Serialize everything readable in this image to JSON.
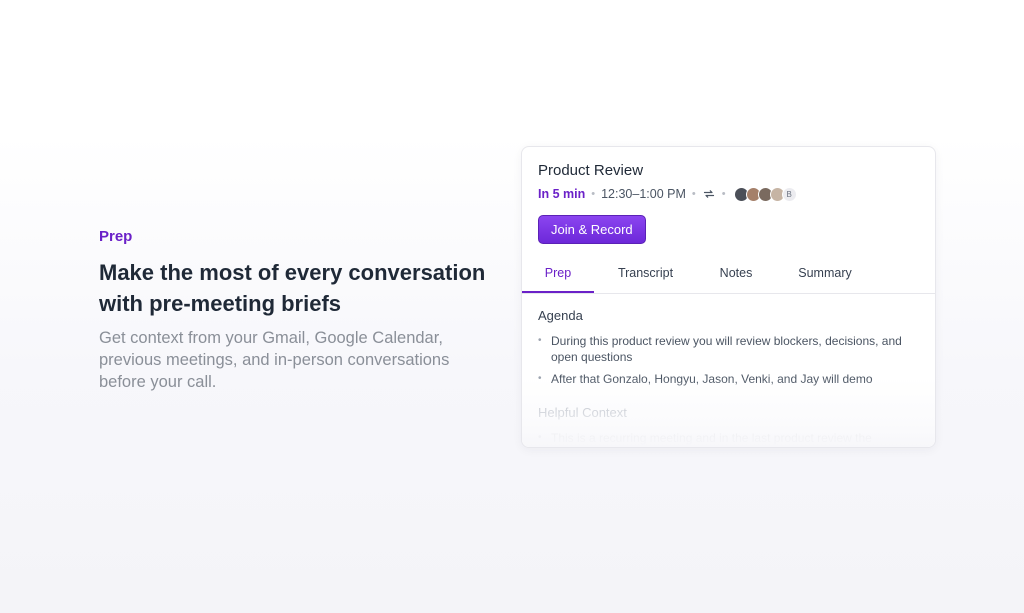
{
  "hero": {
    "eyebrow": "Prep",
    "headline_line1": "Make the most of every conversation",
    "headline_line2": "with pre-meeting briefs",
    "subhead_line1": "Get context from your Gmail, Google Calendar,",
    "subhead_line2": "previous meetings, and in-person conversations",
    "subhead_line3": "before your call."
  },
  "card": {
    "title": "Product Review",
    "starts_in": "In 5 min",
    "time_range": "12:30–1:00 PM",
    "separator": "•",
    "extra_attendee_initial": "B",
    "join_label": "Join & Record",
    "tabs": [
      {
        "label": "Prep"
      },
      {
        "label": "Transcript"
      },
      {
        "label": "Notes"
      },
      {
        "label": "Summary"
      }
    ],
    "agenda_title": "Agenda",
    "agenda_items": [
      "During this product review you will review blockers, decisions, and open questions",
      "After that Gonzalo, Hongyu, Jason, Venki, and Jay will demo"
    ],
    "context_title": "Helpful Context",
    "context_items": [
      "This is a recurring meeting and in the last product review the"
    ]
  },
  "colors": {
    "accent": "#6b21c8",
    "button": "#7c3aed"
  }
}
